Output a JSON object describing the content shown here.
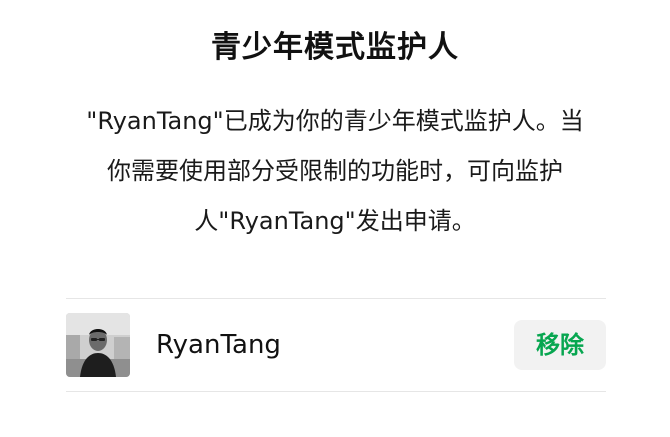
{
  "header": {
    "title": "青少年模式监护人"
  },
  "description": {
    "text": "\"RyanTang\"已成为你的青少年模式监护人。当\n你需要使用部分受限制的功能时，可向监护\n人\"RyanTang\"发出申请。"
  },
  "guardian": {
    "name": "RyanTang",
    "remove_label": "移除",
    "avatar_icon": "person-photo-avatar"
  },
  "colors": {
    "accent": "#07a650",
    "button_bg": "#f2f2f2",
    "divider": "#e6e6e6"
  }
}
